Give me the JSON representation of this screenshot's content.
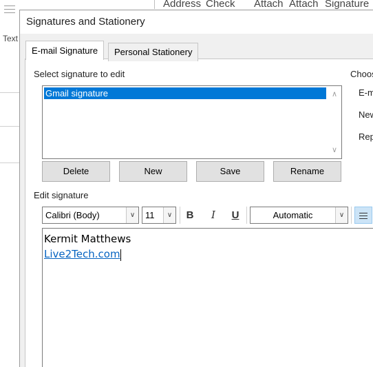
{
  "background": {
    "toolbar_items": [
      "Address",
      "Check",
      "Attach",
      "Attach",
      "Signature"
    ],
    "text_label": "Text"
  },
  "dialog": {
    "title": "Signatures and Stationery",
    "tabs": [
      {
        "label": "E-mail Signature",
        "active": true
      },
      {
        "label": "Personal Stationery",
        "active": false
      }
    ],
    "select_label": "Select signature to edit",
    "signatures": [
      "Gmail signature"
    ],
    "selected_signature": "Gmail signature",
    "buttons": {
      "delete": "Delete",
      "new": "New",
      "save": "Save",
      "rename": "Rename"
    },
    "edit_label": "Edit signature",
    "format": {
      "font": "Calibri (Body)",
      "size": "11",
      "bold": "B",
      "italic": "I",
      "underline": "U",
      "color": "Automatic"
    },
    "editor": {
      "name": "Kermit Matthews",
      "link": "Live2Tech.com"
    },
    "right_panel": {
      "heading": "Choos",
      "email_label": "E-m",
      "new_label": "New",
      "reply_label": "Rep"
    }
  },
  "colors": {
    "selection": "#0078d7",
    "link": "#0563c1",
    "dialog_bg": "#f0f0f0"
  }
}
